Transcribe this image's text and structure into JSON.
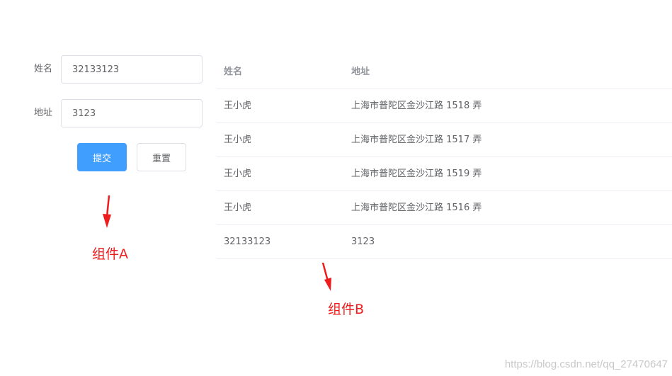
{
  "form": {
    "name_label": "姓名",
    "name_value": "32133123",
    "address_label": "地址",
    "address_value": "3123",
    "submit_label": "提交",
    "reset_label": "重置"
  },
  "table": {
    "headers": {
      "name": "姓名",
      "address": "地址"
    },
    "rows": [
      {
        "name": "王小虎",
        "address": "上海市普陀区金沙江路 1518 弄"
      },
      {
        "name": "王小虎",
        "address": "上海市普陀区金沙江路 1517 弄"
      },
      {
        "name": "王小虎",
        "address": "上海市普陀区金沙江路 1519 弄"
      },
      {
        "name": "王小虎",
        "address": "上海市普陀区金沙江路 1516 弄"
      },
      {
        "name": "32133123",
        "address": "3123"
      }
    ]
  },
  "annotations": {
    "component_a": "组件A",
    "component_b": "组件B"
  },
  "watermark": "https://blog.csdn.net/qq_27470647",
  "colors": {
    "primary": "#409eff",
    "annotation": "#ee1c1c",
    "border": "#dcdfe6"
  }
}
